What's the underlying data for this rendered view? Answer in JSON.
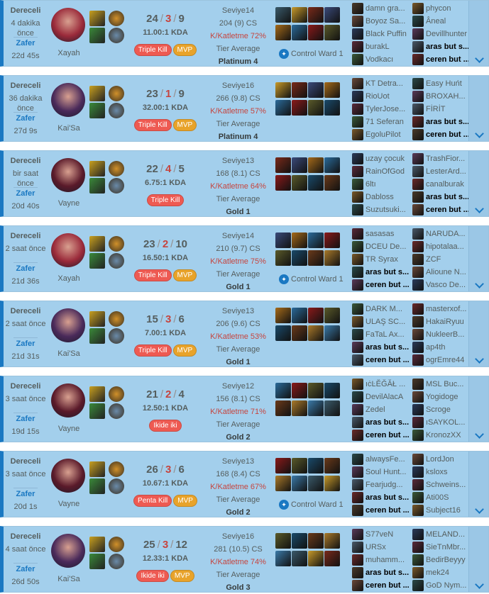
{
  "labels": {
    "cs_suffix": "CS",
    "kda_suffix": "KDA",
    "kp_prefix": "K/Katletme",
    "tier_label": "Tier Average",
    "ward_label": "Control Ward 1"
  },
  "matches": [
    {
      "type": "Dereceli",
      "ago": "4 dakika önce",
      "result": "Zafer",
      "length": "22d 45s",
      "champion": "Xayah",
      "champ_color": "#9a2a3a",
      "kills": "24",
      "deaths": "3",
      "assists": "9",
      "kda": "11.00:1 KDA",
      "badges": [
        "Triple Kill",
        "MVP"
      ],
      "level": "Seviye14",
      "cs": "204 (9) CS",
      "kp": "K/Katletme 72%",
      "tier": "Platinum 4",
      "ward": true,
      "team1": [
        "damn gra...",
        "Boyoz Sa...",
        "Black Puffin",
        "burakL",
        "Vodkacı"
      ],
      "team2": [
        "phycon",
        "Âneal",
        "Devillhunter",
        "aras but s...",
        "ceren but ..."
      ]
    },
    {
      "type": "Dereceli",
      "ago": "36 dakika önce",
      "result": "Zafer",
      "length": "27d 9s",
      "champion": "Kai'Sa",
      "champ_color": "#4a2a5a",
      "kills": "23",
      "deaths": "1",
      "assists": "9",
      "kda": "32.00:1 KDA",
      "badges": [
        "Triple Kill",
        "MVP"
      ],
      "level": "Seviye16",
      "cs": "266 (9.8) CS",
      "kp": "K/Katletme 57%",
      "tier": "Platinum 4",
      "ward": false,
      "team1": [
        "KT Detra...",
        "RioUot",
        "TylerJose...",
        "71 Seferan",
        "EgoluPilot"
      ],
      "team2": [
        "Easy Huńt",
        "BROXAH...",
        "FİRİT",
        "aras but s...",
        "ceren but ..."
      ]
    },
    {
      "type": "Dereceli",
      "ago": "bir saat önce",
      "result": "Zafer",
      "length": "20d 40s",
      "champion": "Vayne",
      "champ_color": "#5a1a2a",
      "kills": "22",
      "deaths": "4",
      "assists": "5",
      "kda": "6.75:1 KDA",
      "badges": [
        "Triple Kill"
      ],
      "level": "Seviye13",
      "cs": "168 (8.1) CS",
      "kp": "K/Katletme 64%",
      "tier": "Gold 1",
      "ward": false,
      "team1": [
        "uzay çocuk",
        "RainOfGod",
        "6ltı",
        "Dabloss",
        "Suzutsuki..."
      ],
      "team2": [
        "TrashFior...",
        "LesterArd...",
        "canalburak",
        "aras but s...",
        "ceren but ..."
      ]
    },
    {
      "type": "Dereceli",
      "ago": "2 saat önce",
      "result": "Zafer",
      "length": "21d 36s",
      "champion": "Xayah",
      "champ_color": "#9a2a3a",
      "kills": "23",
      "deaths": "2",
      "assists": "10",
      "kda": "16.50:1 KDA",
      "badges": [
        "Triple Kill",
        "MVP"
      ],
      "level": "Seviye14",
      "cs": "210 (9.7) CS",
      "kp": "K/Katletme 75%",
      "tier": "Gold 1",
      "ward": true,
      "team1": [
        "sasasas",
        "DCEU De...",
        "TR Syrax",
        "aras but s...",
        "ceren but ..."
      ],
      "team2": [
        "NARUDA...",
        "hipotalaa...",
        "ZCF",
        "Alioune N...",
        "Vasco De..."
      ]
    },
    {
      "type": "Dereceli",
      "ago": "2 saat önce",
      "result": "Zafer",
      "length": "21d 31s",
      "champion": "Kai'Sa",
      "champ_color": "#4a2a5a",
      "kills": "15",
      "deaths": "3",
      "assists": "6",
      "kda": "7.00:1 KDA",
      "badges": [
        "Triple Kill",
        "MVP"
      ],
      "level": "Seviye13",
      "cs": "206 (9.6) CS",
      "kp": "K/Katletme 53%",
      "tier": "Gold 1",
      "ward": false,
      "team1": [
        "DARK M...",
        "ULAŞ SC...",
        "FaTaL Ax...",
        "aras but s...",
        "ceren but ..."
      ],
      "team2": [
        "masterxof...",
        "HakaiRyuu",
        "NukleerB...",
        "ap4th",
        "ogrEmre44"
      ]
    },
    {
      "type": "Dereceli",
      "ago": "3 saat önce",
      "result": "Zafer",
      "length": "19d 15s",
      "champion": "Vayne",
      "champ_color": "#5a1a2a",
      "kills": "21",
      "deaths": "2",
      "assists": "4",
      "kda": "12.50:1 KDA",
      "badges": [
        "Ikide iki"
      ],
      "level": "Seviye12",
      "cs": "156 (8.1) CS",
      "kp": "K/Katletme 71%",
      "tier": "Gold 2",
      "ward": false,
      "team1": [
        "ıċĿĔĞĂŁ ...",
        "DevilAlacA",
        "Zedel",
        "aras but s...",
        "ceren but ..."
      ],
      "team2": [
        "MSL Buc...",
        "Yogidoge",
        "Scroge",
        "ıSAYKOL...",
        "KronozXX"
      ]
    },
    {
      "type": "Dereceli",
      "ago": "3 saat önce",
      "result": "Zafer",
      "length": "20d 1s",
      "champion": "Vayne",
      "champ_color": "#5a1a2a",
      "kills": "26",
      "deaths": "3",
      "assists": "6",
      "kda": "10.67:1 KDA",
      "badges": [
        "Penta Kill",
        "MVP"
      ],
      "level": "Seviye13",
      "cs": "168 (8.4) CS",
      "kp": "K/Katletme 67%",
      "tier": "Gold 2",
      "ward": true,
      "team1": [
        "alwaysFe...",
        "Soul Hunt...",
        "Fearjudg...",
        "aras but s...",
        "ceren but ..."
      ],
      "team2": [
        "LordJon",
        "ksloxs",
        "Schweins...",
        "Ati00S",
        "Subject16"
      ]
    },
    {
      "type": "Dereceli",
      "ago": "4 saat önce",
      "result": "Zafer",
      "length": "26d 50s",
      "champion": "Kai'Sa",
      "champ_color": "#4a2a5a",
      "kills": "25",
      "deaths": "3",
      "assists": "12",
      "kda": "12.33:1 KDA",
      "badges": [
        "Ikide iki",
        "MVP"
      ],
      "level": "Seviye16",
      "cs": "281 (10.5) CS",
      "kp": "K/Katletme 74%",
      "tier": "Gold 3",
      "ward": false,
      "team1": [
        "S77veN",
        "URSx",
        "muhamm...",
        "aras but s...",
        "ceren but ..."
      ],
      "team2": [
        "MELAND...",
        "SieTnMbr...",
        "BedirBeyyy",
        "mek24",
        "GoD Nym..."
      ]
    }
  ]
}
